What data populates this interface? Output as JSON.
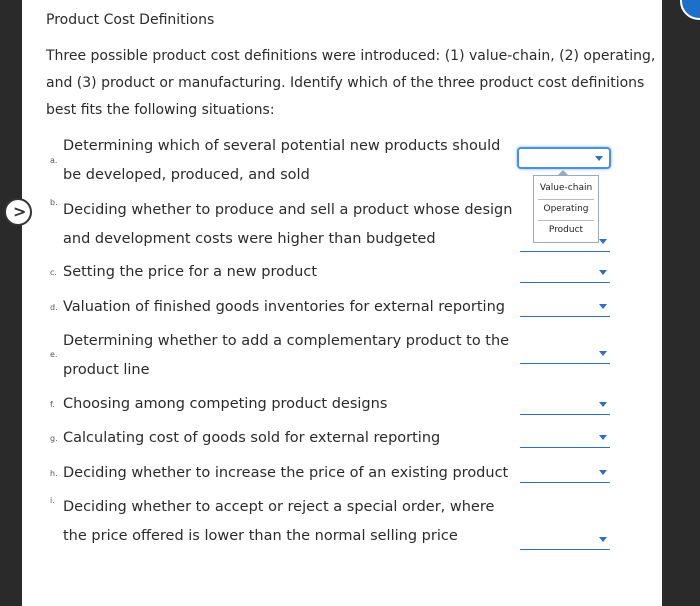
{
  "title": "Product Cost Definitions",
  "intro": "Three possible product cost definitions were introduced: (1) value-chain, (2) operating, and (3) product or manufacturing. Identify which of the three product cost definitions best fits the following situations:",
  "questions": [
    {
      "letter": "a.",
      "text": "Determining which of several potential new products should be developed, produced, and sold"
    },
    {
      "letter": "b.",
      "text": "Deciding whether to produce and sell a product whose design and development costs were higher than budgeted"
    },
    {
      "letter": "c.",
      "text": "Setting the price for a new product"
    },
    {
      "letter": "d.",
      "text": "Valuation of finished goods inventories for external reporting"
    },
    {
      "letter": "e.",
      "text": "Determining whether to add a complementary product to the product line"
    },
    {
      "letter": "f.",
      "text": "Choosing among competing product designs"
    },
    {
      "letter": "g.",
      "text": "Calculating cost of goods sold for external reporting"
    },
    {
      "letter": "h.",
      "text": "Deciding whether to increase the price of an existing product"
    },
    {
      "letter": "i.",
      "text": "Deciding whether to accept or reject a special order, where the price offered is lower than the normal selling price"
    }
  ],
  "dropdown_options": [
    "Value-chain",
    "Operating",
    "Product"
  ],
  "nav": {
    "next_glyph": ">"
  },
  "colors": {
    "accent": "#2f6fbf",
    "focus": "#4a90e2",
    "sidebar": "#2a2a2a"
  }
}
